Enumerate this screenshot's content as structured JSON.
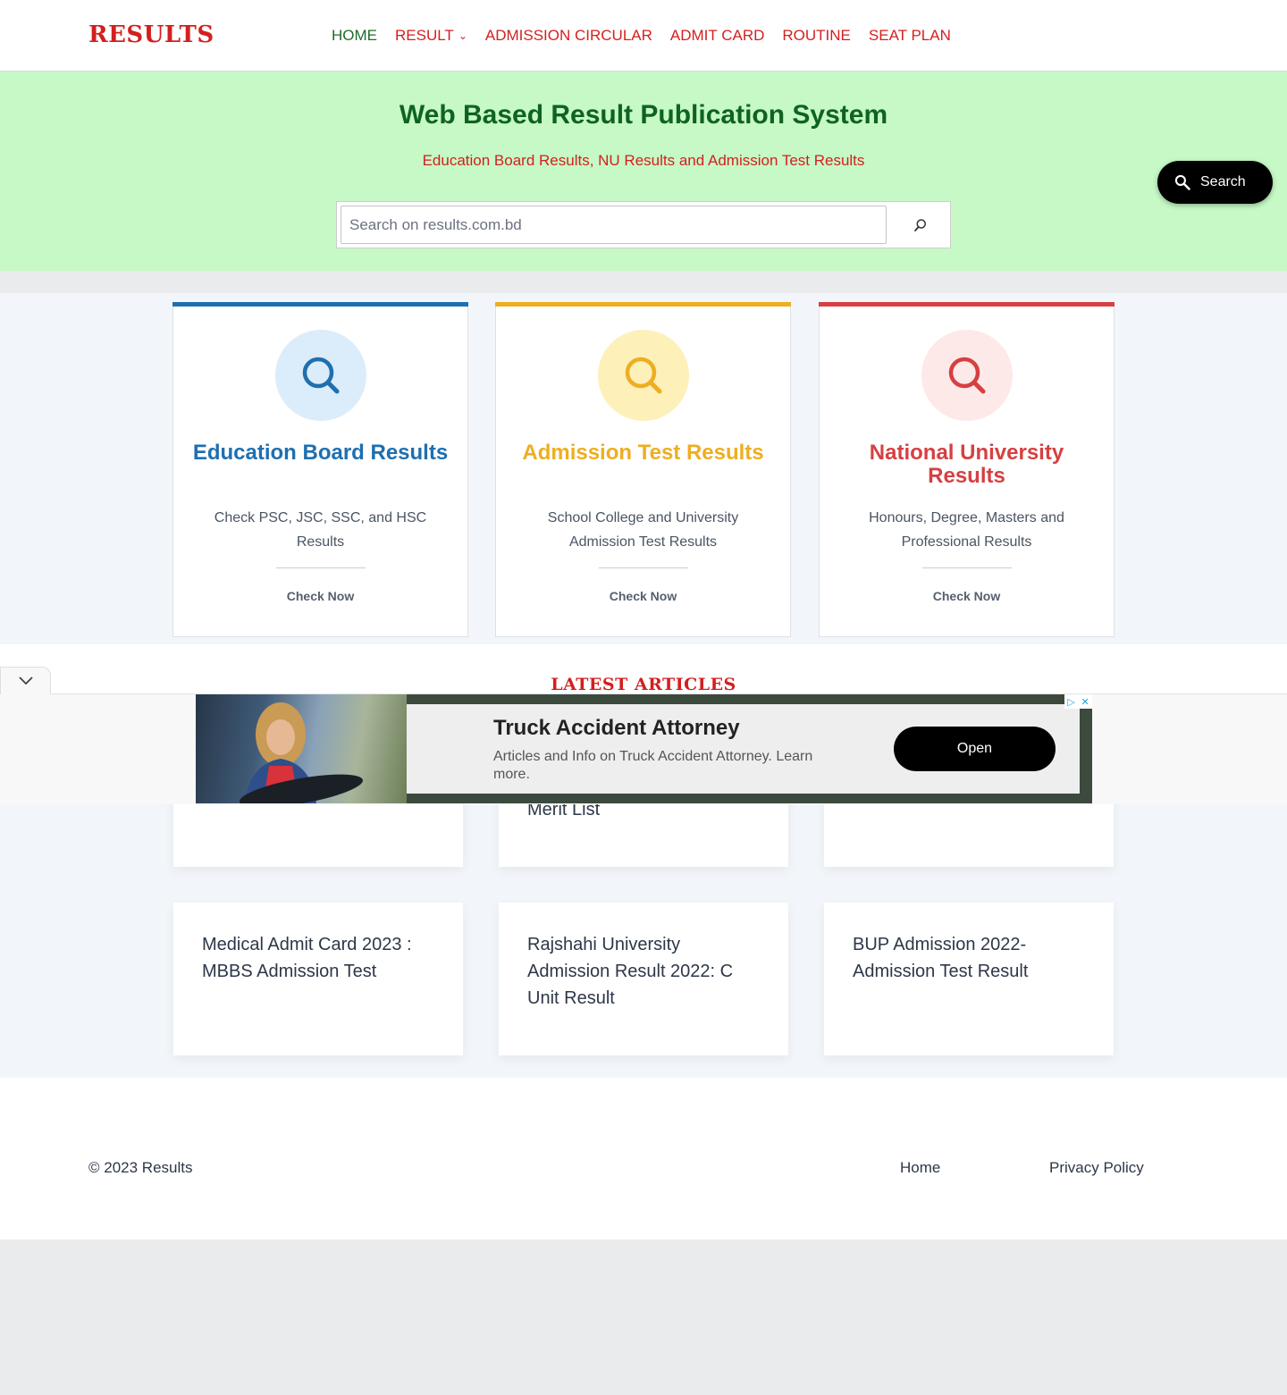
{
  "site": {
    "logo": "RESULTS"
  },
  "nav": {
    "items": [
      {
        "label": "HOME",
        "active": true
      },
      {
        "label": "RESULT",
        "dropdown": true
      },
      {
        "label": "ADMISSION CIRCULAR"
      },
      {
        "label": "ADMIT CARD"
      },
      {
        "label": "ROUTINE"
      },
      {
        "label": "SEAT PLAN"
      }
    ]
  },
  "hero": {
    "title": "Web Based Result Publication System",
    "subtitle": "Education Board Results, NU Results and Admission Test Results",
    "search_placeholder": "Search on results.com.bd",
    "search_icon": "search-icon"
  },
  "floating_search": {
    "label": "Search",
    "icon": "search-icon"
  },
  "cards": [
    {
      "title": "Education Board Results",
      "description": "Check PSC, JSC, SSC, and HSC Results",
      "button": "Check Now",
      "color": "#1e6fb0",
      "tint": "#dbecfa"
    },
    {
      "title": "Admission Test Results",
      "description": "School College and University Admission Test Results",
      "button": "Check Now",
      "color": "#eeae22",
      "tint": "#fdf0b9"
    },
    {
      "title": "National University Results",
      "description": "Honours, Degree, Masters and Professional Results",
      "button": "Check Now",
      "color": "#d64042",
      "tint": "#fde9e8"
    }
  ],
  "latest": {
    "heading": "LATEST ARTICLES",
    "articles": [
      {
        "title": ""
      },
      {
        "title": "Merit List"
      },
      {
        "title": ""
      },
      {
        "title": "Medical Admit Card 2023 : MBBS Admission Test"
      },
      {
        "title": "Rajshahi University Admission Result 2022: C Unit Result"
      },
      {
        "title": "BUP Admission 2022- Admission Test Result"
      }
    ]
  },
  "ad": {
    "headline": "Truck Accident Attorney",
    "body": "Articles and Info on Truck Accident Attorney. Learn more.",
    "button": "Open",
    "collapse_icon": "chevron-down-icon"
  },
  "footer": {
    "copyright": "© 2023 Results",
    "links": [
      "Home",
      "Privacy Policy"
    ]
  }
}
